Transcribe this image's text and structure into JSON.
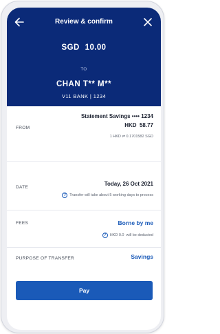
{
  "header": {
    "title": "Review & confirm",
    "amount_currency": "SGD",
    "amount_value": "10.00",
    "to_label": "TO",
    "payee_name": "CHAN T** M**",
    "payee_bank": "V11 BANK | 1234",
    "color": "#0b2a78"
  },
  "from": {
    "label": "FROM",
    "account": "Statement Savings •••• 1234",
    "converted_amount": "HKD  58.77",
    "rate": "1 HKD ⇌ 0.1701582 SGD"
  },
  "date": {
    "label": "DATE",
    "value": "Today, 26 Oct 2021",
    "note": "Transfer will take about 5 working days to process"
  },
  "fees": {
    "label": "FEES",
    "value": "Borne by me",
    "note": "HKD 0.0  will be deducted"
  },
  "purpose": {
    "label": "PURPOSE OF TRANSFER",
    "value": "Savings"
  },
  "actions": {
    "pay_label": "Pay",
    "accent": "#1a5ab8"
  },
  "icons": [
    "back-arrow-icon",
    "close-icon",
    "info-icon"
  ]
}
